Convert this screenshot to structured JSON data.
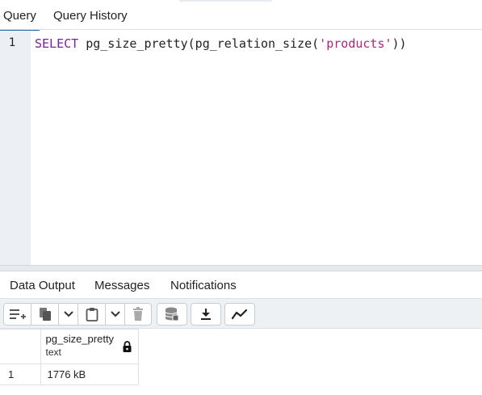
{
  "query_tabs": [
    {
      "label": "Query",
      "active": true
    },
    {
      "label": "Query History",
      "active": false
    }
  ],
  "editor": {
    "line_number": "1",
    "sql": {
      "keyword": "SELECT",
      "part1": " pg_size_pretty(pg_relation_size(",
      "string": "'products'",
      "part2": "))"
    }
  },
  "result_tabs": [
    {
      "label": "Data Output",
      "active": true
    },
    {
      "label": "Messages",
      "active": false
    },
    {
      "label": "Notifications",
      "active": false
    }
  ],
  "toolbar": {
    "icons": [
      "add-row-icon",
      "copy-icon",
      "chevron-down-icon",
      "paste-icon",
      "chevron-down-icon",
      "delete-icon",
      "save-data-icon",
      "download-icon",
      "graph-icon"
    ]
  },
  "grid": {
    "columns": [
      {
        "name": "pg_size_pretty",
        "type": "text",
        "locked": true
      }
    ],
    "rows": [
      {
        "num": "1",
        "values": [
          "1776 kB"
        ]
      }
    ]
  },
  "colors": {
    "accent": "#326690",
    "keyword": "#7b1ea2",
    "string": "#b0257a",
    "gutter": "#eceff3"
  }
}
